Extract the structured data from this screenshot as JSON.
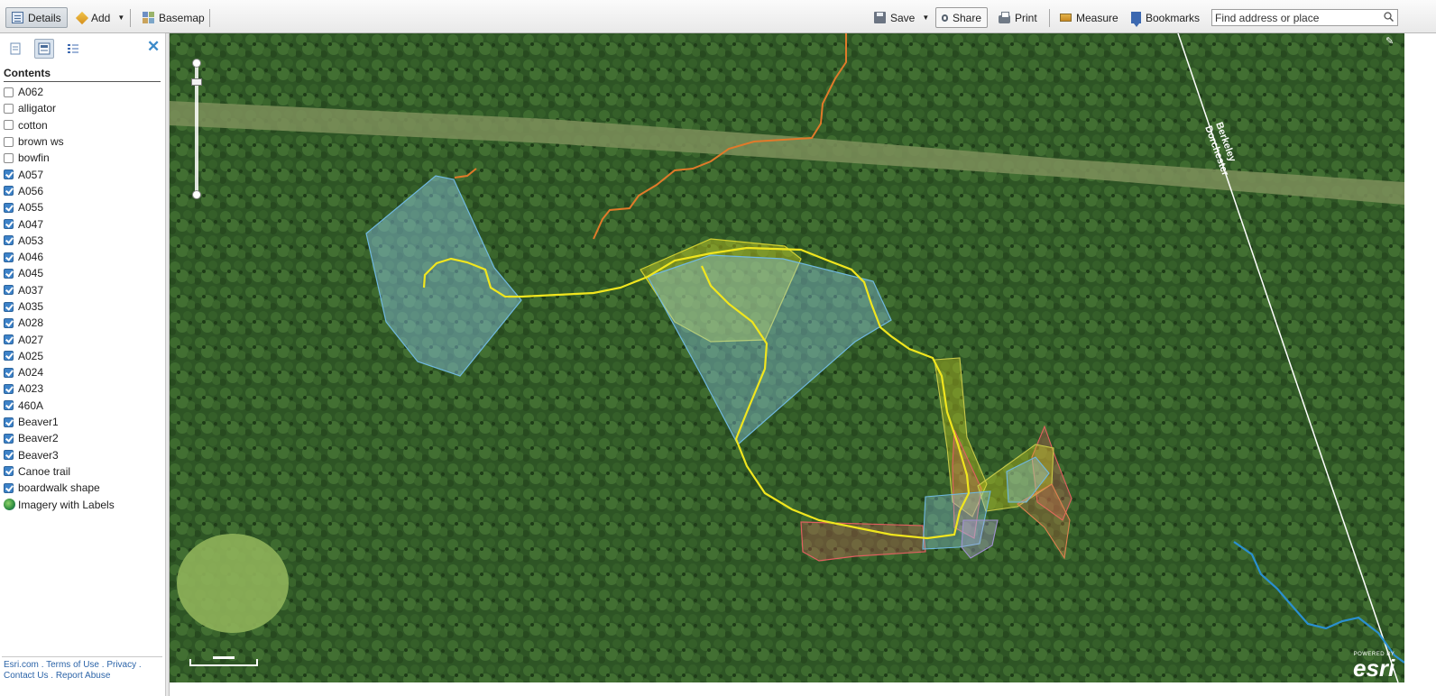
{
  "toolbar": {
    "details_label": "Details",
    "add_label": "Add",
    "basemap_label": "Basemap",
    "save_label": "Save",
    "share_label": "Share",
    "print_label": "Print",
    "measure_label": "Measure",
    "bookmarks_label": "Bookmarks",
    "search_placeholder": "Find address or place"
  },
  "panel": {
    "contents_title": "Contents",
    "tabs": [
      "about",
      "contents",
      "legend"
    ],
    "layers": [
      {
        "name": "A062",
        "checked": false
      },
      {
        "name": "alligator",
        "checked": false
      },
      {
        "name": "cotton",
        "checked": false
      },
      {
        "name": "brown ws",
        "checked": false
      },
      {
        "name": "bowfin",
        "checked": false
      },
      {
        "name": "A057",
        "checked": true
      },
      {
        "name": "A056",
        "checked": true
      },
      {
        "name": "A055",
        "checked": true
      },
      {
        "name": "A047",
        "checked": true
      },
      {
        "name": "A053",
        "checked": true
      },
      {
        "name": "A046",
        "checked": true
      },
      {
        "name": "A045",
        "checked": true
      },
      {
        "name": "A037",
        "checked": true
      },
      {
        "name": "A035",
        "checked": true
      },
      {
        "name": "A028",
        "checked": true
      },
      {
        "name": "A027",
        "checked": true
      },
      {
        "name": "A025",
        "checked": true
      },
      {
        "name": "A024",
        "checked": true
      },
      {
        "name": "A023",
        "checked": true
      },
      {
        "name": "460A",
        "checked": true
      },
      {
        "name": "Beaver1",
        "checked": true
      },
      {
        "name": "Beaver2",
        "checked": true
      },
      {
        "name": "Beaver3",
        "checked": true
      },
      {
        "name": "Canoe trail",
        "checked": true
      },
      {
        "name": "boardwalk shape",
        "checked": true
      }
    ],
    "basemap_layer": "Imagery with Labels",
    "footer": {
      "esri_com": "Esri.com",
      "terms": "Terms of Use",
      "privacy": "Privacy",
      "contact": "Contact Us",
      "report": "Report Abuse",
      "sep": "."
    }
  },
  "map": {
    "boundary_label_1": "Berkeley",
    "boundary_label_2": "Dorchester",
    "logo_powered": "POWERED BY",
    "logo_word": "esri",
    "colors": {
      "imagery": "#2f5a26",
      "trail_yellow": "#f0e61e",
      "trail_orange": "#e07a2a",
      "stream_blue": "#2a8fd0",
      "poly_blue": "#8cc8e8",
      "poly_red": "#e06060",
      "poly_yellow": "#d8d820"
    }
  }
}
